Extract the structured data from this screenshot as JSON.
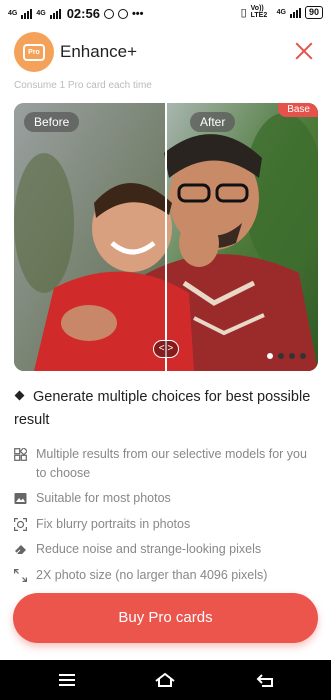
{
  "status_bar": {
    "network1": "4G",
    "network2": "4G",
    "time": "02:56",
    "lte_label": "Vo)) LTE2",
    "network3": "4G",
    "battery": "90"
  },
  "header": {
    "logo_text": "Pro",
    "title": "Enhance+"
  },
  "faded_text": "Consume 1 Pro card each time",
  "compare": {
    "before_label": "Before",
    "after_label": "After",
    "base_label": "Base",
    "handle_glyph": "< >"
  },
  "headline": "Generate multiple choices for best possible result",
  "features": [
    {
      "icon": "grid-icon",
      "text": "Multiple results from our selective models for you to choose"
    },
    {
      "icon": "image-icon",
      "text": "Suitable for most photos"
    },
    {
      "icon": "face-focus-icon",
      "text": "Fix blurry portraits in photos"
    },
    {
      "icon": "eraser-icon",
      "text": "Reduce noise and strange-looking pixels"
    },
    {
      "icon": "expand-icon",
      "text": "2X photo size (no larger than 4096 pixels)"
    }
  ],
  "buy_button": "Buy Pro cards",
  "colors": {
    "accent": "#ec554c",
    "logo": "#f4a25a",
    "feature_text": "#888888"
  }
}
